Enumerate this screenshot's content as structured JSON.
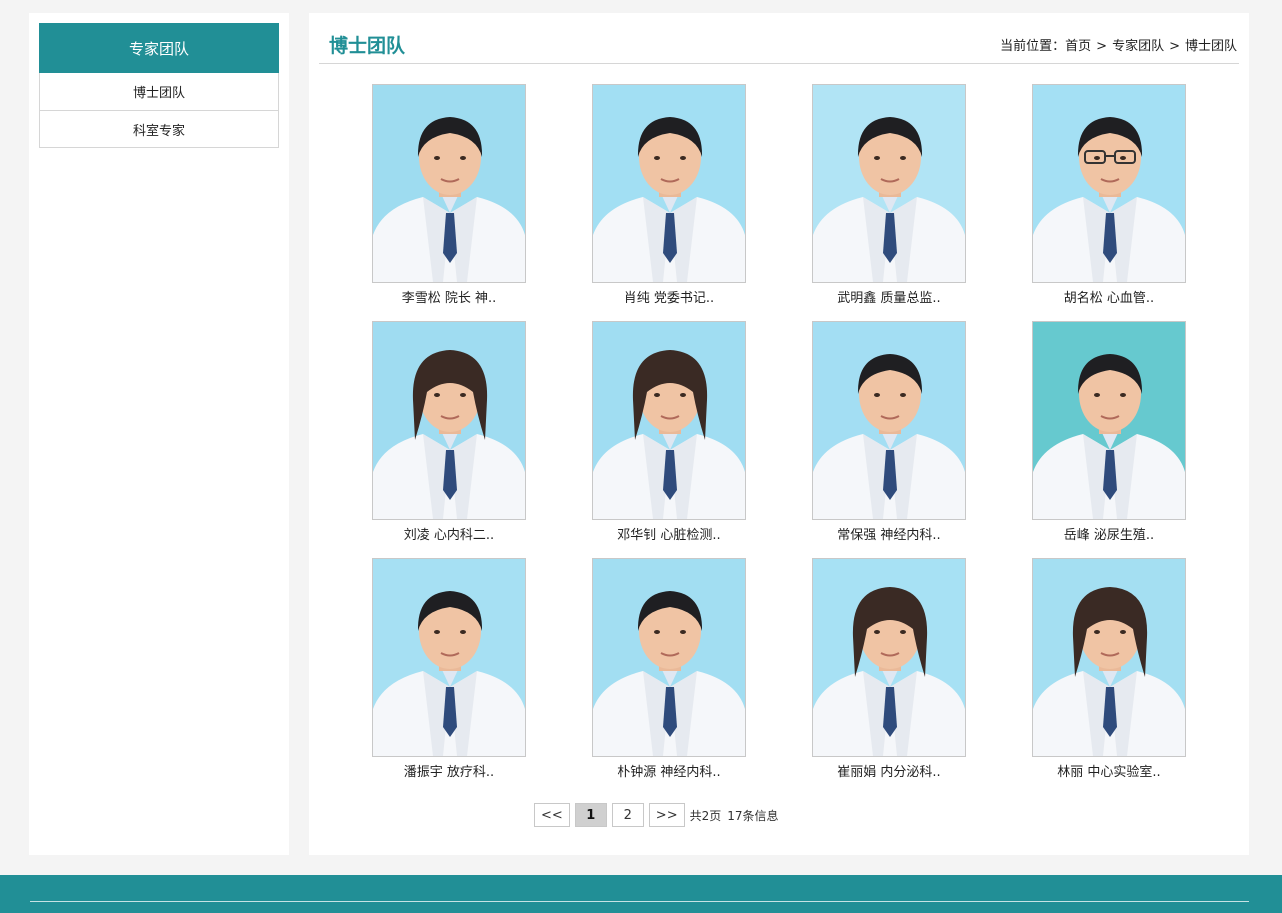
{
  "sidebar": {
    "title": "专家团队",
    "items": [
      {
        "label": "博士团队"
      },
      {
        "label": "科室专家"
      }
    ]
  },
  "main": {
    "title": "博士团队",
    "breadcrumb": {
      "prefix": "当前位置：",
      "items": [
        "首页",
        "专家团队",
        "博士团队"
      ],
      "separator": ">"
    }
  },
  "experts": [
    {
      "caption": "李雪松 院长 神..",
      "bg": "#9edcf0",
      "gender": "m",
      "glasses": false
    },
    {
      "caption": "肖纯 党委书记..",
      "bg": "#a2dff3",
      "gender": "m",
      "glasses": false
    },
    {
      "caption": "武明鑫 质量总监..",
      "bg": "#b1e4f5",
      "gender": "m",
      "glasses": false
    },
    {
      "caption": "胡名松 心血管..",
      "bg": "#a4e0f4",
      "gender": "m",
      "glasses": true
    },
    {
      "caption": "刘凌 心内科二..",
      "bg": "#9fdcf1",
      "gender": "f",
      "glasses": false
    },
    {
      "caption": "邓华钊 心脏检测..",
      "bg": "#a0ddf2",
      "gender": "f",
      "glasses": false
    },
    {
      "caption": "常保强 神经内科..",
      "bg": "#a3def3",
      "gender": "m",
      "glasses": false
    },
    {
      "caption": "岳峰 泌尿生殖..",
      "bg": "#66c9cf",
      "gender": "m",
      "glasses": false
    },
    {
      "caption": "潘振宇 放疗科..",
      "bg": "#a6e0f3",
      "gender": "m",
      "glasses": false
    },
    {
      "caption": "朴钟源 神经内科..",
      "bg": "#a2def2",
      "gender": "m",
      "glasses": false
    },
    {
      "caption": "崔丽娟 内分泌科..",
      "bg": "#a7e1f4",
      "gender": "f",
      "glasses": false
    },
    {
      "caption": "林丽 中心实验室..",
      "bg": "#a4dff2",
      "gender": "f",
      "glasses": false
    }
  ],
  "pagination": {
    "prev": "<<",
    "pages": [
      "1",
      "2"
    ],
    "current": "1",
    "next": ">>",
    "total_pages": "共2页",
    "total_items": "17条信息"
  },
  "colors": {
    "accent": "#218f96"
  }
}
